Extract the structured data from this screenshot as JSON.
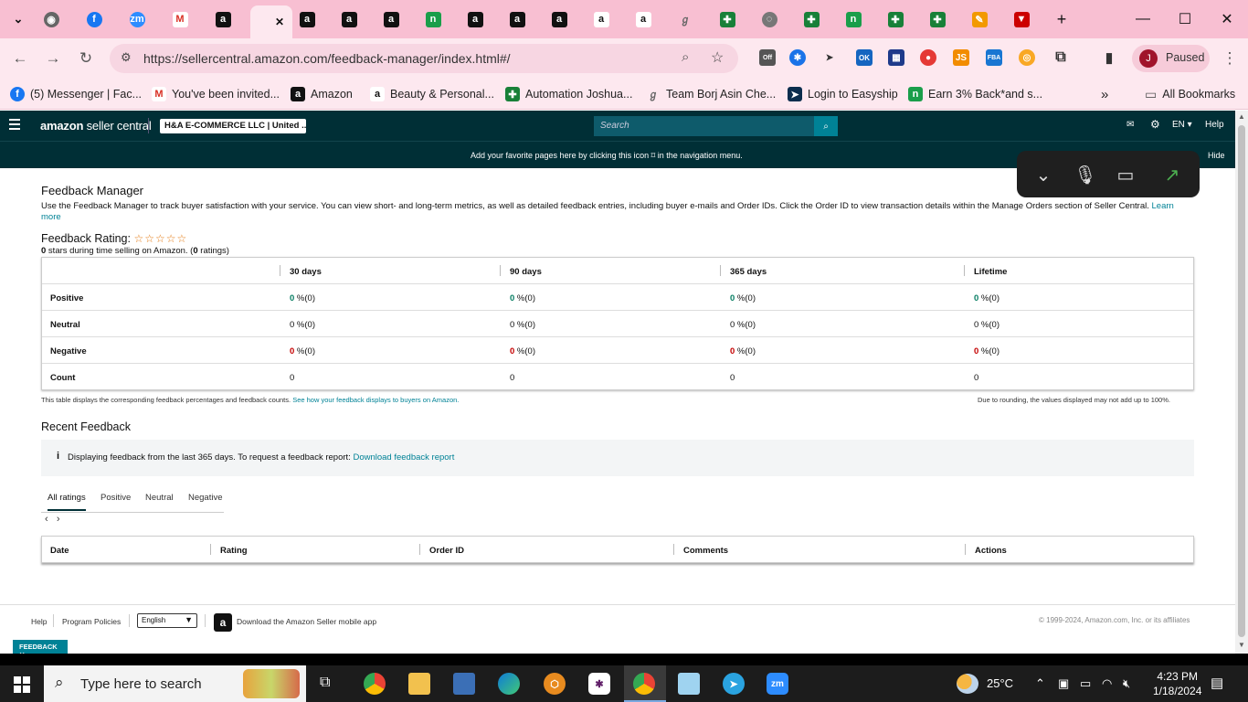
{
  "browser": {
    "tab_close": "✕",
    "new_tab": "+",
    "url": "https://sellercentral.amazon.com/feedback-manager/index.html#/",
    "profile": "Paused",
    "profile_initial": "J",
    "ext_off": "Off",
    "ext_ok": "OK",
    "ext_js": "JS",
    "ext_fba": "FBA",
    "bookmarks": [
      {
        "label": "(5) Messenger | Fac...",
        "icon": "facebook-icon"
      },
      {
        "label": "You've been invited...",
        "icon": "gmail-icon"
      },
      {
        "label": "Amazon",
        "icon": "amazon-icon"
      },
      {
        "label": "Beauty & Personal...",
        "icon": "amazon-icon"
      },
      {
        "label": "Automation Joshua...",
        "icon": "sheets-icon"
      },
      {
        "label": "Team Borj Asin Che...",
        "icon": "doc-icon"
      },
      {
        "label": "Login to Easyship",
        "icon": "easyship-icon"
      },
      {
        "label": "Earn 3% Back*and s...",
        "icon": "brand-icon"
      }
    ],
    "all_bookmarks": "All Bookmarks"
  },
  "amazon": {
    "logo_a": "amazon",
    "logo_b": " seller central",
    "account": "H&A E-COMMERCE LLC | United ...",
    "search_placeholder": "Search",
    "lang": "EN ▾",
    "help": "Help",
    "fav_msg": "Add your favorite pages here by clicking this icon ⌑ in the navigation menu.",
    "hide": "Hide"
  },
  "feedback": {
    "title": "Feedback Manager",
    "description": "Use the Feedback Manager to track buyer satisfaction with your service. You can view short- and long-term metrics, as well as detailed feedback entries, including buyer e-mails and Order IDs. Click the Order ID to view transaction details within the Manage Orders section of Seller Central.",
    "learn_more": "Learn more",
    "rating_label": "Feedback Rating:",
    "stars": "☆☆☆☆☆",
    "stars_count": "0",
    "rating_mid": " stars during time selling on Amazon. (",
    "ratings_count": "0",
    "rating_end": " ratings)",
    "columns": [
      "30 days",
      "90 days",
      "365 days",
      "Lifetime"
    ],
    "rows": [
      {
        "label": "Positive",
        "cells": [
          {
            "num": "0",
            "rest": " %(0)"
          },
          {
            "num": "0",
            "rest": " %(0)"
          },
          {
            "num": "0",
            "rest": " %(0)"
          },
          {
            "num": "0",
            "rest": " %(0)"
          }
        ]
      },
      {
        "label": "Neutral",
        "cells": [
          {
            "num": "0",
            "rest": " %(0)"
          },
          {
            "num": "0",
            "rest": " %(0)"
          },
          {
            "num": "0",
            "rest": " %(0)"
          },
          {
            "num": "0",
            "rest": " %(0)"
          }
        ]
      },
      {
        "label": "Negative",
        "cells": [
          {
            "num": "0",
            "rest": " %(0)"
          },
          {
            "num": "0",
            "rest": " %(0)"
          },
          {
            "num": "0",
            "rest": " %(0)"
          },
          {
            "num": "0",
            "rest": " %(0)"
          }
        ]
      },
      {
        "label": "Count",
        "cells": [
          {
            "num": "",
            "rest": "0"
          },
          {
            "num": "",
            "rest": "0"
          },
          {
            "num": "",
            "rest": "0"
          },
          {
            "num": "",
            "rest": "0"
          }
        ]
      }
    ],
    "note_left": "This table displays the corresponding feedback percentages and feedback counts.",
    "note_link": "See how your feedback displays to buyers on Amazon.",
    "note_right": "Due to rounding, the values displayed may not add up to 100%."
  },
  "recent": {
    "title": "Recent Feedback",
    "info_icon": "i",
    "info": "Displaying feedback from the last 365 days. To request a feedback report:",
    "download": "Download feedback report",
    "tabs": [
      "All ratings",
      "Positive",
      "Neutral",
      "Negative"
    ],
    "prev": "‹",
    "next": "›",
    "headers": [
      "Date",
      "Rating",
      "Order ID",
      "Comments",
      "Actions"
    ]
  },
  "footer": {
    "help": "Help",
    "policies": "Program Policies",
    "language": "English",
    "app": "Download the Amazon Seller mobile app",
    "copyright": "© 1999-2024, Amazon.com, Inc. or its affiliates",
    "feedback_tag": "FEEDBACK ✕"
  },
  "taskbar": {
    "search_placeholder": "Type here to search",
    "weather": "25°C",
    "time": "4:23 PM",
    "date": "1/18/2024"
  },
  "colors": {
    "tabbar": "#f8bfd2",
    "amazon_dark": "#002f36",
    "teal": "#008296",
    "positive": "#067d62",
    "negative": "#c40000"
  }
}
